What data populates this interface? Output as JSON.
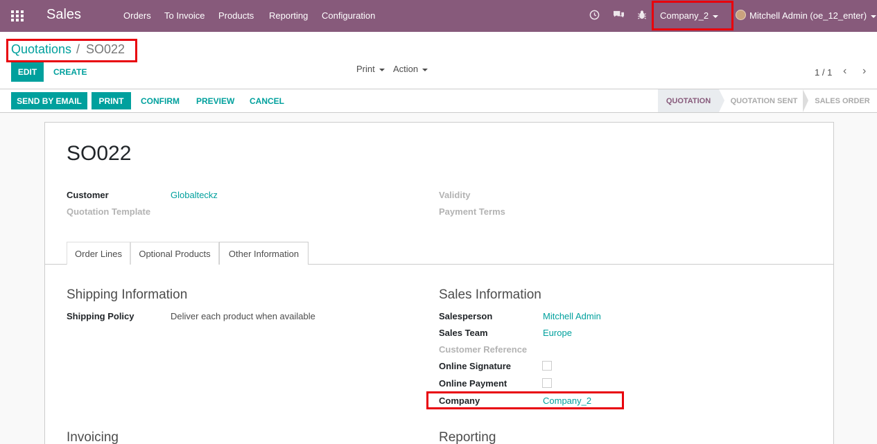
{
  "navbar": {
    "app_title": "Sales",
    "menus": [
      "Orders",
      "To Invoice",
      "Products",
      "Reporting",
      "Configuration"
    ],
    "company": "Company_2",
    "user": "Mitchell Admin (oe_12_enter)",
    "icons": [
      "clock-icon",
      "chat-icon",
      "bug-icon"
    ]
  },
  "breadcrumb": {
    "parent": "Quotations",
    "separator": "/",
    "current": "SO022"
  },
  "control": {
    "edit": "EDIT",
    "create": "CREATE",
    "print": "Print",
    "action": "Action",
    "pager": "1 / 1"
  },
  "statusbar": {
    "buttons": [
      "SEND BY EMAIL",
      "PRINT"
    ],
    "links": [
      "CONFIRM",
      "PREVIEW",
      "CANCEL"
    ],
    "stages": [
      "QUOTATION",
      "QUOTATION SENT",
      "SALES ORDER"
    ],
    "active_stage": "QUOTATION"
  },
  "form": {
    "title": "SO022",
    "customer_label": "Customer",
    "customer_value": "Globalteckz",
    "template_label": "Quotation Template",
    "validity_label": "Validity",
    "payment_terms_label": "Payment Terms",
    "tabs": [
      "Order Lines",
      "Optional Products",
      "Other Information"
    ],
    "active_tab": "Other Information",
    "shipping": {
      "heading": "Shipping Information",
      "policy_label": "Shipping Policy",
      "policy_value": "Deliver each product when available"
    },
    "sales": {
      "heading": "Sales Information",
      "salesperson_label": "Salesperson",
      "salesperson_value": "Mitchell Admin",
      "team_label": "Sales Team",
      "team_value": "Europe",
      "customer_ref_label": "Customer Reference",
      "online_signature_label": "Online Signature",
      "online_payment_label": "Online Payment",
      "company_label": "Company",
      "company_value": "Company_2"
    },
    "invoicing_heading": "Invoicing",
    "reporting_heading": "Reporting"
  },
  "colors": {
    "navbar": "#875a7b",
    "accent": "#00a09d",
    "highlight": "#e8000c"
  }
}
